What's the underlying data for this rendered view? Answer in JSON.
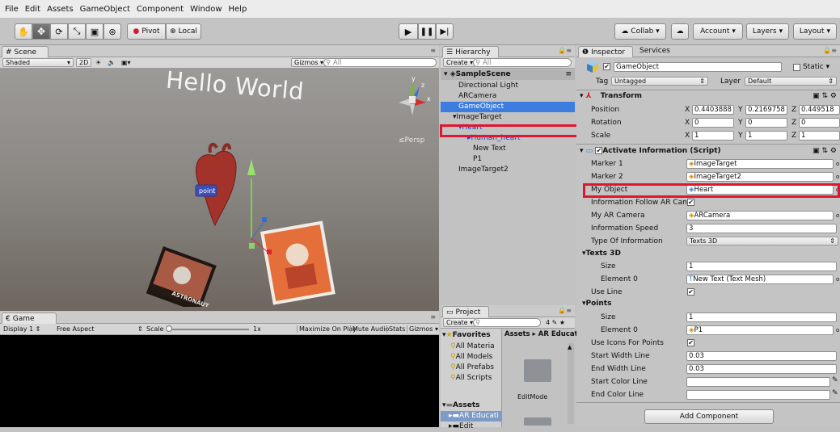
{
  "menu": [
    "File",
    "Edit",
    "Assets",
    "GameObject",
    "Component",
    "Window",
    "Help"
  ],
  "toolbar": {
    "pivot": "Pivot",
    "local": "Local",
    "collab": "Collab ▾",
    "account": "Account",
    "layers": "Layers",
    "layout": "Layout"
  },
  "scene": {
    "tab": "Scene",
    "shaded": "Shaded",
    "twod": "2D",
    "gizmos": "Gizmos ▾",
    "search": "All",
    "hello": "Hello World",
    "persp": "Persp",
    "point": "point",
    "card_text": "ASTRONAUT",
    "axis_y": "y",
    "axis_x": "x",
    "axis_z": "z"
  },
  "game": {
    "tab": "Game",
    "display": "Display 1",
    "aspect": "Free Aspect",
    "scale_label": "Scale",
    "scale_value": "1x",
    "maximize": "Maximize On Play",
    "mute": "Mute Audio",
    "stats": "Stats",
    "gizmos": "Gizmos ▾"
  },
  "hierarchy": {
    "tab": "Hierarchy",
    "create": "Create ▾",
    "search": "All",
    "scene": "SampleScene",
    "items": [
      "Directional Light",
      "ARCamera",
      "GameObject",
      "ImageTarget",
      "Heart",
      "Human_heart",
      "New Text",
      "P1",
      "ImageTarget2"
    ]
  },
  "project": {
    "tab": "Project",
    "create": "Create ▾",
    "favorites": "Favorites",
    "fav_items": [
      "All Materia",
      "All Models",
      "All Prefabs",
      "All Scripts"
    ],
    "assets": "Assets",
    "asset_items": [
      "AR Educati",
      "Edit"
    ],
    "breadcrumb": "Assets ▸ AR Education",
    "folder": "EditMode"
  },
  "inspector": {
    "tab": "Inspector",
    "services": "Services",
    "object_name": "GameObject",
    "static": "Static",
    "tag_label": "Tag",
    "tag_value": "Untagged",
    "layer_label": "Layer",
    "layer_value": "Default",
    "transform": "Transform",
    "position": {
      "label": "Position",
      "x": "0.4403888",
      "y": "0.2169758",
      "z": "0.449518"
    },
    "rotation": {
      "label": "Rotation",
      "x": "0",
      "y": "0",
      "z": "0"
    },
    "scale": {
      "label": "Scale",
      "x": "1",
      "y": "1",
      "z": "1"
    },
    "script_title": "Activate Information (Script)",
    "fields": [
      {
        "label": "Marker 1",
        "value": "ImageTarget"
      },
      {
        "label": "Marker 2",
        "value": "ImageTarget2"
      },
      {
        "label": "My Object",
        "value": "Heart"
      },
      {
        "label": "Information Follow AR Camer",
        "value": "✔"
      },
      {
        "label": "My AR Camera",
        "value": "ARCamera"
      },
      {
        "label": "Information Speed",
        "value": "3"
      },
      {
        "label": "Type Of Information",
        "value": "Texts 3D"
      }
    ],
    "texts3d": "Texts 3D",
    "size_label": "Size",
    "texts_size": "1",
    "element0": "Element 0",
    "texts_el0": "New Text (Text Mesh)",
    "use_line": "Use Line",
    "points": "Points",
    "points_size": "1",
    "points_el0": "P1",
    "use_icons": "Use Icons For Points",
    "start_width": "Start Width Line",
    "start_width_v": "0.03",
    "end_width": "End Width Line",
    "end_width_v": "0.03",
    "start_color": "Start Color Line",
    "end_color": "End Color Line",
    "add_component": "Add Component"
  }
}
